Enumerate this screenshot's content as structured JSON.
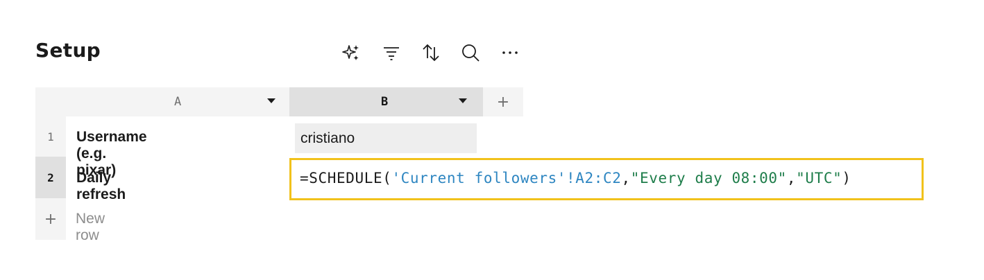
{
  "sheet": {
    "title": "Setup"
  },
  "toolbar": {
    "icons": [
      "sparkle-ai-icon",
      "filter-icon",
      "sort-icon",
      "search-icon",
      "more-icon"
    ]
  },
  "columns": [
    {
      "label": "A"
    },
    {
      "label": "B"
    }
  ],
  "rows": [
    {
      "number": "1",
      "label": "Username (e.g. pixar)",
      "value": "cristiano"
    },
    {
      "number": "2",
      "label": "Daily refresh"
    }
  ],
  "formula": {
    "prefix": "=SCHEDULE(",
    "ref": "'Current followers'!A2:C2",
    "sep1": ",",
    "arg1": "\"Every day 08:00\"",
    "sep2": ",",
    "arg2": "\"UTC\"",
    "suffix": ")"
  },
  "new_row": {
    "plus": "+",
    "label": "New row"
  },
  "add_column": {
    "plus": "+"
  },
  "colors": {
    "formula_border": "#f1c21b",
    "formula_reference": "#2e86c1",
    "formula_string": "#1e7d4a"
  }
}
